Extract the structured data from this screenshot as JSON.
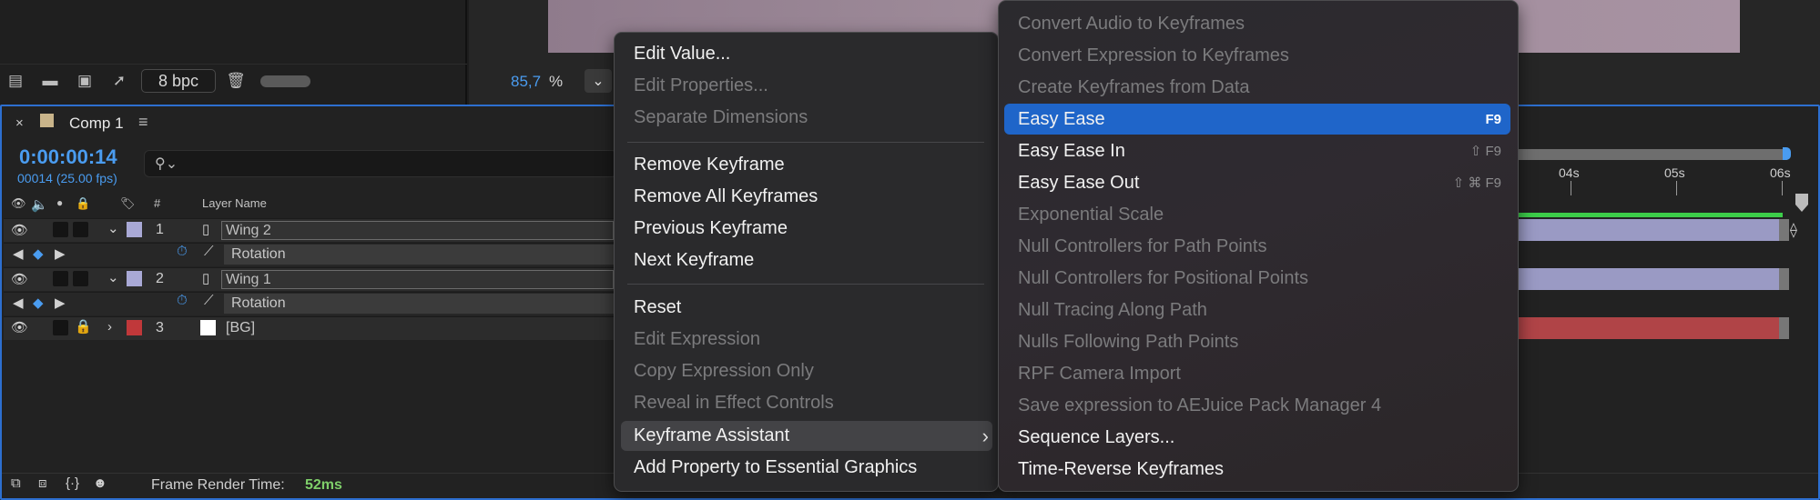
{
  "project_toolbar": {
    "bpc": "8 bpc"
  },
  "viewer": {
    "zoom_value": "85,7",
    "zoom_unit": "%"
  },
  "comp_tab": {
    "title": "Comp 1"
  },
  "timeline": {
    "timecode": "0:00:00:14",
    "frames_fps": "00014 (25.00 fps)",
    "col_number": "#",
    "col_layer_name": "Layer Name",
    "ruler_ticks": [
      "04s",
      "05s",
      "06s"
    ],
    "layers": [
      {
        "index": "1",
        "name": "Wing 2",
        "property": "Rotation",
        "label_color": "#a9a9d6"
      },
      {
        "index": "2",
        "name": "Wing 1",
        "property": "Rotation",
        "label_color": "#a9a9d6"
      },
      {
        "index": "3",
        "name": "[BG]",
        "label_color": "#c0383a"
      }
    ],
    "status_label": "Frame Render Time:",
    "status_value": "52ms"
  },
  "context_menu": {
    "items": [
      {
        "label": "Edit Value...",
        "enabled": true
      },
      {
        "label": "Edit Properties...",
        "enabled": false
      },
      {
        "label": "Separate Dimensions",
        "enabled": false
      },
      {
        "label": "Remove Keyframe",
        "enabled": true
      },
      {
        "label": "Remove All Keyframes",
        "enabled": true
      },
      {
        "label": "Previous Keyframe",
        "enabled": true
      },
      {
        "label": "Next Keyframe",
        "enabled": true
      },
      {
        "label": "Reset",
        "enabled": true
      },
      {
        "label": "Edit Expression",
        "enabled": false
      },
      {
        "label": "Copy Expression Only",
        "enabled": false
      },
      {
        "label": "Reveal in Effect Controls",
        "enabled": false
      },
      {
        "label": "Keyframe Assistant",
        "enabled": true,
        "submenu": true
      },
      {
        "label": "Add Property to Essential Graphics",
        "enabled": true
      }
    ]
  },
  "submenu": {
    "items": [
      {
        "label": "Convert Audio to Keyframes",
        "enabled": false
      },
      {
        "label": "Convert Expression to Keyframes",
        "enabled": false
      },
      {
        "label": "Create Keyframes from Data",
        "enabled": false
      },
      {
        "label": "Easy Ease",
        "enabled": true,
        "shortcut": "F9",
        "highlighted": true
      },
      {
        "label": "Easy Ease In",
        "enabled": true,
        "shortcut": "⇧ F9"
      },
      {
        "label": "Easy Ease Out",
        "enabled": true,
        "shortcut": "⇧ ⌘ F9"
      },
      {
        "label": "Exponential Scale",
        "enabled": false
      },
      {
        "label": "Null Controllers for Path Points",
        "enabled": false
      },
      {
        "label": "Null Controllers for Positional Points",
        "enabled": false
      },
      {
        "label": "Null Tracing Along Path",
        "enabled": false
      },
      {
        "label": "Nulls Following Path Points",
        "enabled": false
      },
      {
        "label": "RPF Camera Import",
        "enabled": false
      },
      {
        "label": "Save expression to AEJuice Pack Manager 4",
        "enabled": false
      },
      {
        "label": "Sequence Layers...",
        "enabled": true
      },
      {
        "label": "Time-Reverse Keyframes",
        "enabled": true
      }
    ]
  },
  "colors": {
    "accent": "#2d6fd0",
    "highlight": "#1f65c9",
    "timecode": "#4a9cf0",
    "status_ok": "#7fd06a"
  }
}
